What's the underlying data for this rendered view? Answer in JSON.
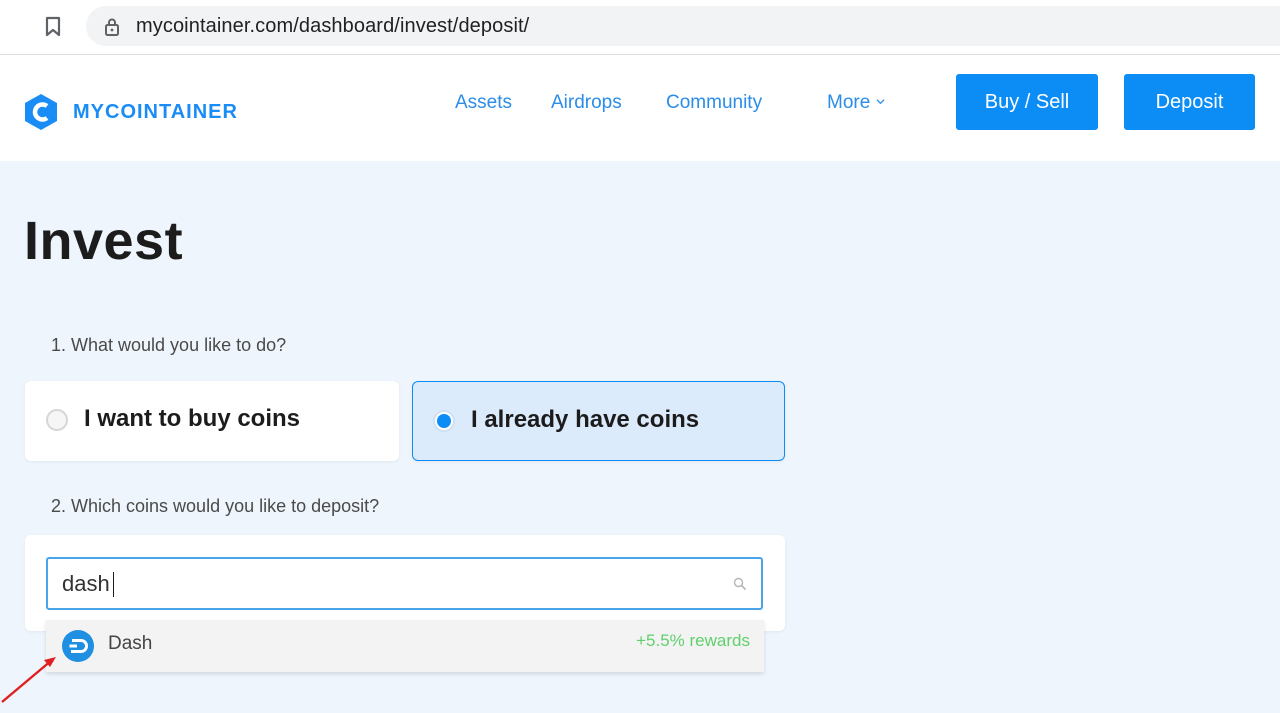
{
  "browser": {
    "url": "mycointainer.com/dashboard/invest/deposit/"
  },
  "header": {
    "logo_text": "MYCOINTAINER",
    "nav": {
      "assets": "Assets",
      "airdrops": "Airdrops",
      "community": "Community",
      "more": "More"
    },
    "buy_sell_label": "Buy / Sell",
    "deposit_label": "Deposit"
  },
  "page": {
    "title": "Invest",
    "question_1": "1. What would you like to do?",
    "option_buy": "I want to buy coins",
    "option_have": "I already have coins",
    "selected_option": "I already have coins",
    "question_2": "2. Which coins would you like to deposit?",
    "search_value": "dash",
    "results": [
      {
        "name": "Dash",
        "rewards": "+5.5% rewards"
      }
    ]
  },
  "colors": {
    "accent": "#0b8df5",
    "background": "#eef5fc",
    "rewards": "#5fd06c"
  }
}
